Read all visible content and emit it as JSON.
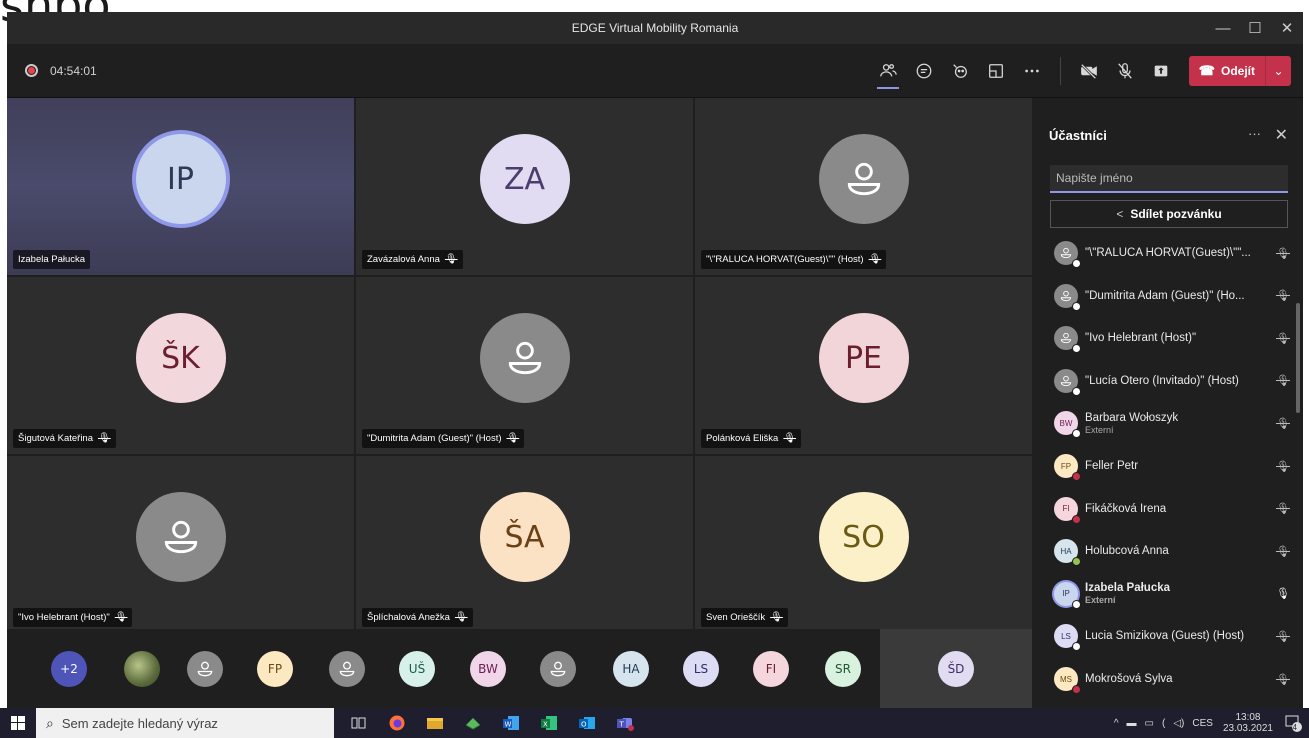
{
  "background_text": "snpo...",
  "window": {
    "title": "EDGE Virtual Mobility Romania",
    "controls": [
      "—",
      "☐",
      "✕"
    ]
  },
  "toolbar": {
    "recording_time": "04:54:01",
    "leave_label": "Odejít"
  },
  "tiles": [
    {
      "name": "Izabela Pałucka",
      "initials": "IP",
      "bg": "#c9d6ee",
      "fg": "#2b3a55",
      "muted": false,
      "ring": true,
      "highlight": true
    },
    {
      "name": "Zavázalová Anna",
      "initials": "ZA",
      "bg": "#e1dcf1",
      "fg": "#4a3e6e",
      "muted": true
    },
    {
      "name": "\"\\\"RALUCA HORVAT(Guest)\\\"\" (Host)",
      "initials": "",
      "bg": "#8a8a8a",
      "fg": "#ffffff",
      "muted": true,
      "icon": "person-icon"
    },
    {
      "name": "Šigutová Kateřina",
      "initials": "ŠK",
      "bg": "#f2d7dc",
      "fg": "#6b1f2e",
      "muted": true
    },
    {
      "name": "\"Dumitrita Adam (Guest)\" (Host)",
      "initials": "",
      "bg": "#8a8a8a",
      "fg": "#ffffff",
      "muted": true,
      "icon": "person-icon"
    },
    {
      "name": "Polánková Eliška",
      "initials": "PE",
      "bg": "#f2d5d9",
      "fg": "#6b1f2e",
      "muted": true
    },
    {
      "name": "\"Ivo Helebrant (Host)\"",
      "initials": "",
      "bg": "#8a8a8a",
      "fg": "#ffffff",
      "muted": true,
      "icon": "person-icon"
    },
    {
      "name": "Šplíchalová Anežka",
      "initials": "ŠA",
      "bg": "#fbe2c4",
      "fg": "#6b4014",
      "muted": true
    },
    {
      "name": "Sven Orieščík",
      "initials": "SO",
      "bg": "#fbf0c8",
      "fg": "#6b5a14",
      "muted": true
    }
  ],
  "strip": [
    {
      "label": "+2",
      "bg": "#4f54b8",
      "fg": "#ffffff"
    },
    {
      "label": "",
      "bg": "#7a8a5a",
      "fg": "#ffffff",
      "photo": true
    },
    {
      "label": "",
      "bg": "#8a8a8a",
      "fg": "#ffffff",
      "icon": "person-icon"
    },
    {
      "label": "FP",
      "bg": "#fde9c1",
      "fg": "#6b4a14"
    },
    {
      "label": "",
      "bg": "#8a8a8a",
      "fg": "#ffffff",
      "icon": "person-icon"
    },
    {
      "label": "UŠ",
      "bg": "#d7f1ea",
      "fg": "#185a4a"
    },
    {
      "label": "BW",
      "bg": "#f1d5e9",
      "fg": "#6b1f55"
    },
    {
      "label": "",
      "bg": "#8a8a8a",
      "fg": "#ffffff",
      "icon": "person-icon"
    },
    {
      "label": "HA",
      "bg": "#d6e4ee",
      "fg": "#1f3a55"
    },
    {
      "label": "LS",
      "bg": "#dcdcf4",
      "fg": "#2d2d6b"
    },
    {
      "label": "FI",
      "bg": "#f4d6dc",
      "fg": "#6b1f2e"
    },
    {
      "label": "SR",
      "bg": "#d9f2df",
      "fg": "#1f5a2e"
    },
    {
      "label": "ŠD",
      "bg": "#e2dcf2",
      "fg": "#3e2e6b",
      "self": true
    }
  ],
  "panel": {
    "title": "Účastníci",
    "search_placeholder": "Napište jméno",
    "invite_label": "Sdílet pozvánku",
    "participants": [
      {
        "name": "\"\\\"RALUCA HORVAT(Guest)\\\"\"...",
        "sub": "",
        "initials": "",
        "bg": "#8a8a8a",
        "fg": "#ffffff",
        "status": "#ffffff",
        "mic": "muted"
      },
      {
        "name": "\"Dumitrita Adam (Guest)\" (Ho...",
        "sub": "",
        "initials": "",
        "bg": "#8a8a8a",
        "fg": "#ffffff",
        "status": "#ffffff",
        "mic": "muted"
      },
      {
        "name": "\"Ivo Helebrant (Host)\"",
        "sub": "",
        "initials": "",
        "bg": "#8a8a8a",
        "fg": "#ffffff",
        "status": "#ffffff",
        "mic": "muted"
      },
      {
        "name": "\"Lucía Otero (Invitado)\" (Host)",
        "sub": "",
        "initials": "",
        "bg": "#8a8a8a",
        "fg": "#ffffff",
        "status": "#ffffff",
        "mic": "muted"
      },
      {
        "name": "Barbara Wołoszyk",
        "sub": "Externí",
        "initials": "BW",
        "bg": "#f1d5e9",
        "fg": "#6b1f55",
        "status": "#ffffff",
        "mic": "muted"
      },
      {
        "name": "Feller Petr",
        "sub": "",
        "initials": "FP",
        "bg": "#fde9c1",
        "fg": "#6b4a14",
        "status": "#c4314b",
        "mic": "muted"
      },
      {
        "name": "Fikáčková Irena",
        "sub": "",
        "initials": "FI",
        "bg": "#f4d6dc",
        "fg": "#6b1f2e",
        "status": "#c4314b",
        "mic": "muted"
      },
      {
        "name": "Holubcová Anna",
        "sub": "",
        "initials": "HA",
        "bg": "#d6e4ee",
        "fg": "#1f3a55",
        "status": "#92c353",
        "mic": "muted"
      },
      {
        "name": "Izabela Pałucka",
        "sub": "Externí",
        "initials": "IP",
        "bg": "#c9d6ee",
        "fg": "#2b3a55",
        "status": "#ffffff",
        "mic": "on",
        "bold": true,
        "ring": true
      },
      {
        "name": "Lucia Smizikova (Guest) (Host)",
        "sub": "",
        "initials": "LS",
        "bg": "#dcdcf4",
        "fg": "#2d2d6b",
        "status": "#ffffff",
        "mic": "muted"
      },
      {
        "name": "Mokrošová Sylva",
        "sub": "",
        "initials": "MS",
        "bg": "#fde9c1",
        "fg": "#6b4a14",
        "status": "#c4314b",
        "mic": "muted"
      }
    ]
  },
  "taskbar": {
    "search_placeholder": "Sem zadejte hledaný výraz",
    "language": "CES",
    "time": "13:08",
    "date": "23.03.2021",
    "notifications": "4"
  }
}
